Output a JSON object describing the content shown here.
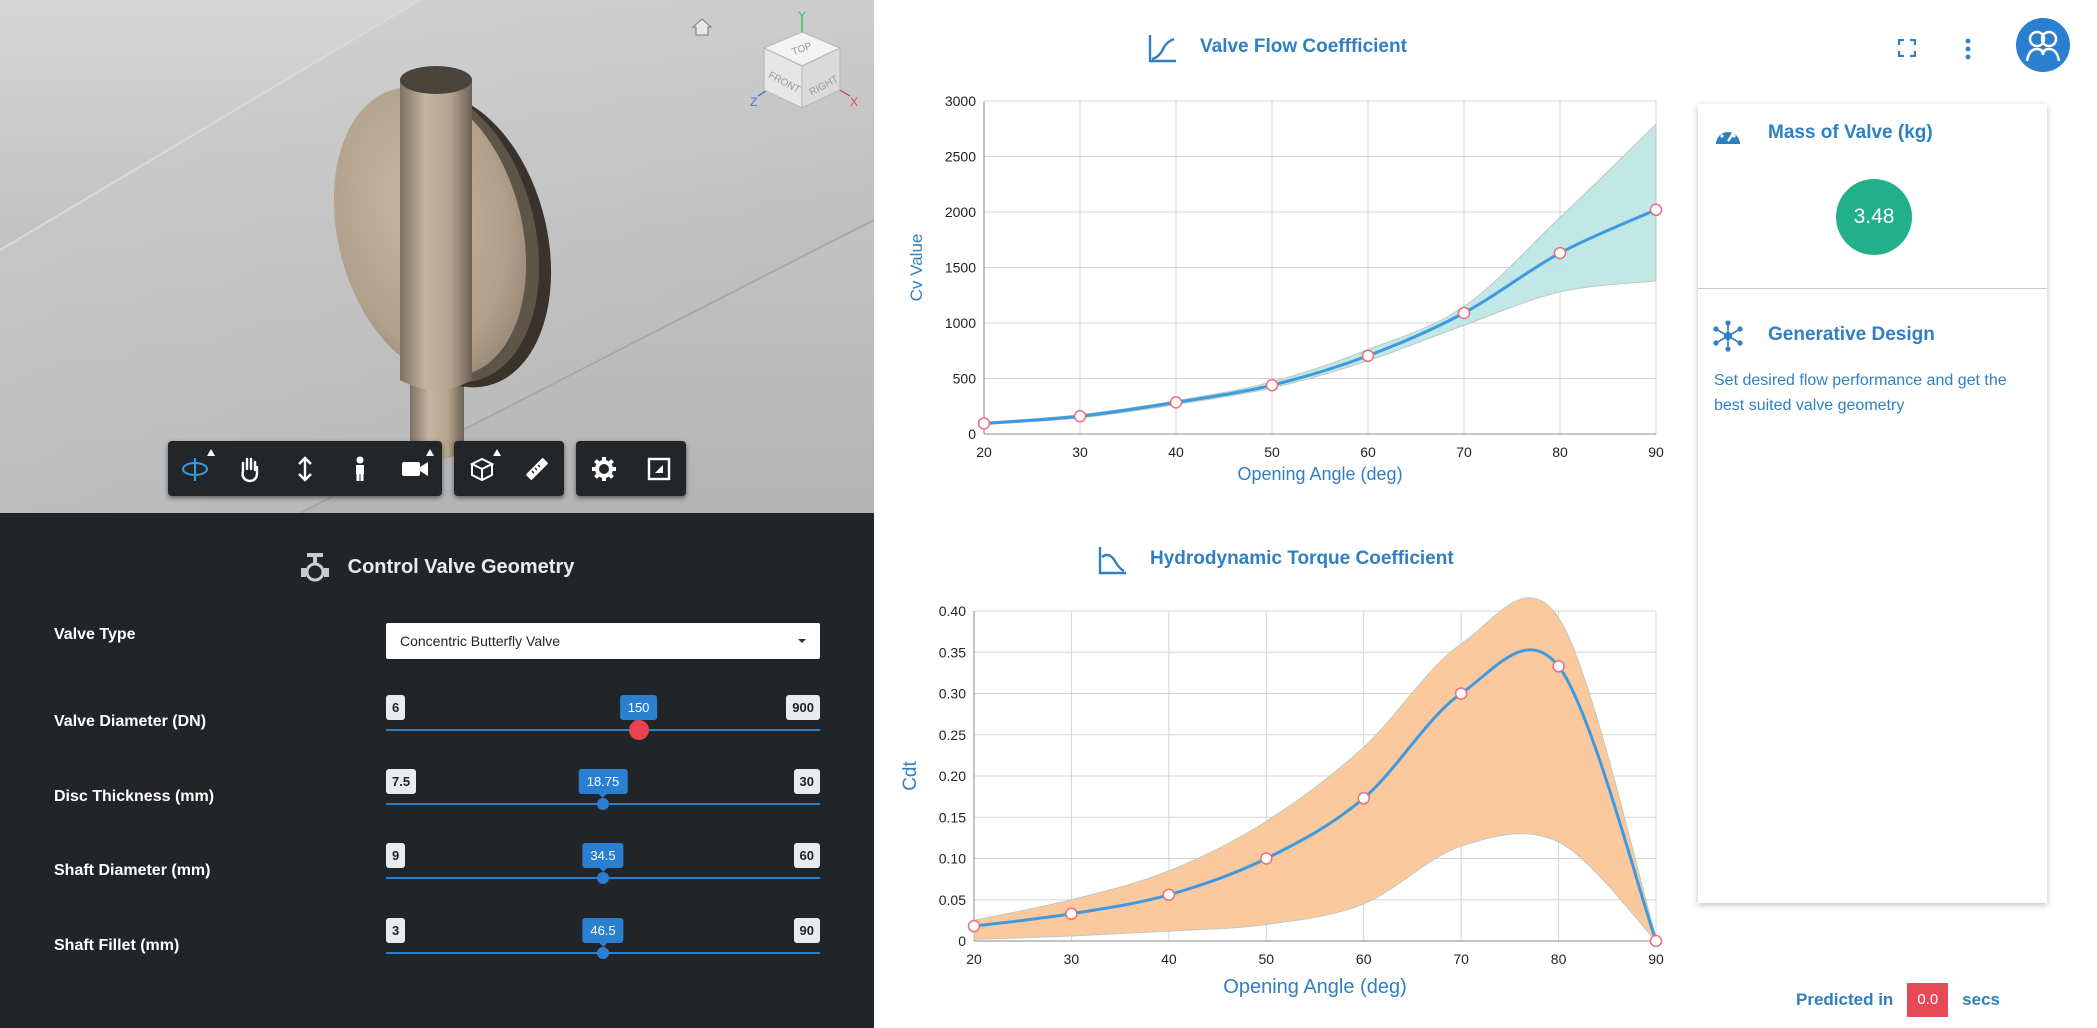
{
  "viewer": {
    "viewcube": {
      "top": "TOP",
      "front": "FRONT",
      "right": "RIGHT",
      "axis_x": "X",
      "axis_y": "Y",
      "axis_z": "Z"
    },
    "toolbar": {
      "groups": [
        [
          "orbit-icon",
          "pan-icon",
          "zoom-icon",
          "first-person-icon",
          "camera-icon"
        ],
        [
          "explode-model-icon",
          "measure-icon"
        ],
        [
          "settings-gear-icon",
          "fullscreen-icon"
        ]
      ]
    }
  },
  "control_panel": {
    "title": "Control Valve Geometry",
    "icon": "valve-icon",
    "valve_type": {
      "label": "Valve Type",
      "value": "Concentric Butterfly Valve"
    },
    "sliders": [
      {
        "label": "Valve Diameter (DN)",
        "min": "6",
        "max": "900",
        "value": "150",
        "fraction": 0.582
      },
      {
        "label": "Disc Thickness (mm)",
        "min": "7.5",
        "max": "30",
        "value": "18.75",
        "fraction": 0.5
      },
      {
        "label": "Shaft Diameter (mm)",
        "min": "9",
        "max": "60",
        "value": "34.5",
        "fraction": 0.5
      },
      {
        "label": "Shaft Fillet (mm)",
        "min": "3",
        "max": "90",
        "value": "46.5",
        "fraction": 0.5
      }
    ]
  },
  "header_icons": [
    "fullscreen-icon",
    "more-vertical-icon",
    "user-avatar-icon"
  ],
  "chart_data": [
    {
      "type": "line",
      "title": "Valve Flow Coeffficient",
      "xlabel": "Opening Angle (deg)",
      "ylabel": "Cv Value",
      "x": [
        20,
        30,
        40,
        50,
        60,
        70,
        80,
        90
      ],
      "xticks": [
        20,
        30,
        40,
        50,
        60,
        70,
        80,
        90
      ],
      "yticks": [
        0,
        500,
        1000,
        1500,
        2000,
        2500,
        3000
      ],
      "xlim": [
        20,
        90
      ],
      "ylim": [
        0,
        3000
      ],
      "series": [
        {
          "values": [
            95,
            160,
            285,
            440,
            705,
            1090,
            1630,
            2020
          ]
        }
      ],
      "band": {
        "x": [
          20,
          30,
          40,
          50,
          60,
          70,
          80,
          90
        ],
        "upper": [
          105,
          175,
          300,
          470,
          760,
          1150,
          1950,
          2790
        ],
        "lower": [
          85,
          145,
          265,
          415,
          660,
          980,
          1280,
          1380
        ]
      },
      "line_color": "#3d9ae0",
      "band_color": "#bfe6e6",
      "grid": true
    },
    {
      "type": "line",
      "title": "Hydrodynamic Torque Coefficient",
      "xlabel": "Opening Angle (deg)",
      "ylabel": "Cdt",
      "x": [
        20,
        30,
        40,
        50,
        60,
        70,
        80,
        90
      ],
      "xticks": [
        20,
        30,
        40,
        50,
        60,
        70,
        80,
        90
      ],
      "yticks": [
        "0",
        "0.05",
        "0.10",
        "0.15",
        "0.20",
        "0.25",
        "0.30",
        "0.35",
        "0.40"
      ],
      "xlim": [
        20,
        90
      ],
      "ylim": [
        0,
        0.4
      ],
      "series": [
        {
          "values": [
            0.018,
            0.033,
            0.056,
            0.1,
            0.173,
            0.3,
            0.333,
            0.0
          ]
        }
      ],
      "band": {
        "x": [
          20,
          30,
          40,
          50,
          60,
          70,
          80,
          90
        ],
        "upper": [
          0.025,
          0.05,
          0.085,
          0.145,
          0.235,
          0.36,
          0.392,
          0.005
        ],
        "lower": [
          0.002,
          0.006,
          0.012,
          0.02,
          0.045,
          0.115,
          0.12,
          0.0
        ]
      },
      "line_color": "#3d9ae0",
      "band_color": "#fcc79a",
      "grid": true
    }
  ],
  "mass_card": {
    "title": "Mass of Valve (kg)",
    "value": "3.48",
    "icon": "speedometer-icon",
    "color": "#21b089"
  },
  "generative_card": {
    "title": "Generative Design",
    "description": "Set desired flow performance and get the best suited valve geometry",
    "icon": "network-icon"
  },
  "prediction": {
    "prefix": "Predicted in",
    "value": "0.0",
    "suffix": "secs"
  }
}
